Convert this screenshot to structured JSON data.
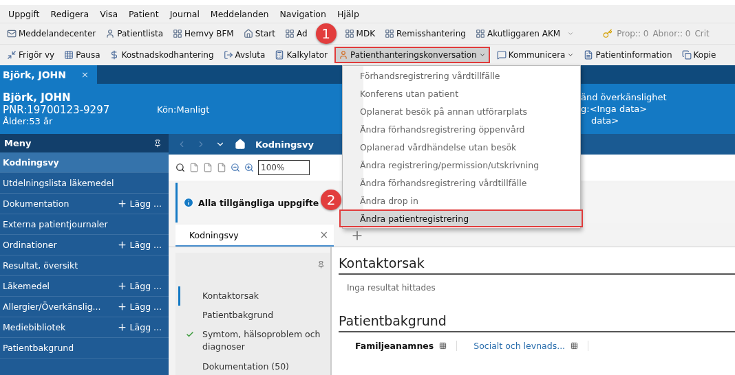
{
  "menu_bar": [
    "Uppgift",
    "Redigera",
    "Visa",
    "Patient",
    "Journal",
    "Meddelanden",
    "Navigation",
    "Hjälp"
  ],
  "toolbar_1": {
    "items": [
      {
        "label": "Meddelandecenter"
      },
      {
        "label": "Patientlista"
      },
      {
        "label": "Hemvy BFM"
      },
      {
        "label": "Start"
      },
      {
        "label": "Ad"
      },
      {
        "label": "MDK"
      },
      {
        "label": "Remisshantering"
      },
      {
        "label": "Akutliggaren AKM"
      }
    ],
    "counters": [
      "Prop:: 0",
      "Abnor:: 0",
      "Crit"
    ]
  },
  "toolbar_2": [
    {
      "label": "Frigör vy",
      "has_menu": false
    },
    {
      "label": "Pausa",
      "has_menu": false
    },
    {
      "label": "Kostnadskodhantering",
      "has_menu": false
    },
    {
      "label": "Avsluta",
      "has_menu": false
    },
    {
      "label": "Kalkylator",
      "has_menu": false
    },
    {
      "label": "Patienthanteringskonversation",
      "has_menu": true,
      "selected": true,
      "callout": "1"
    },
    {
      "label": "Kommunicera",
      "has_menu": true,
      "selected": false
    },
    {
      "label": "Patientinformation",
      "has_menu": false
    },
    {
      "label": "Kopie",
      "has_menu": false
    }
  ],
  "dropdown_menu": [
    {
      "label": "Förhandsregistrering vårdtillfälle",
      "selected": false
    },
    {
      "label": "Konferens utan patient",
      "selected": false
    },
    {
      "label": "Oplanerat besök på annan utförarplats",
      "selected": false
    },
    {
      "label": "Ändra förhandsregistrering öppenvård",
      "selected": false
    },
    {
      "label": "Oplanerad vårdhändelse utan besök",
      "selected": false
    },
    {
      "label": "Ändra registrering/permission/utskrivning",
      "selected": false
    },
    {
      "label": "Ändra förhandsregistrering vårdtillfälle",
      "selected": false
    },
    {
      "label": "Ändra drop in",
      "selected": false
    },
    {
      "label": "Ändra patientregistrering",
      "selected": true,
      "callout": "2"
    }
  ],
  "patient_tab": {
    "label": "Björk, JOHN",
    "close": "×"
  },
  "patient_header": {
    "name": "Björk, JOHN",
    "pnr": "PNR:19700123-9297",
    "age": "Ålder:53 år",
    "gender": "Kön:Manligt",
    "right_lines": [
      "änd överkänslighet",
      "g:<Inga data>",
      "data>"
    ]
  },
  "sidebar": {
    "title": "Meny",
    "items": [
      {
        "label": "Kodningsvy",
        "selected": true
      },
      {
        "label": "Utdelningslista läkemedel",
        "selected": false
      },
      {
        "label": "Dokumentation",
        "selected": false,
        "action": "Lägg ..."
      },
      {
        "label": "Externa patientjournaler",
        "selected": false
      },
      {
        "label": "Ordinationer",
        "selected": false,
        "action": "Lägg ..."
      },
      {
        "label": "Resultat, översikt",
        "selected": false
      },
      {
        "label": "Läkemedel",
        "selected": false,
        "action": "Lägg ..."
      },
      {
        "label": "Allergier/Överkänslig...",
        "selected": false,
        "action": "Lägg ..."
      },
      {
        "label": "Mediebibliotek",
        "selected": false,
        "action": "Lägg ..."
      },
      {
        "label": "Patientbakgrund",
        "selected": false
      }
    ]
  },
  "nav_bar": {
    "title": "Kodningsvy"
  },
  "view_toolbar": {
    "zoom": "100%"
  },
  "info_bar": {
    "text": "Alla tillgängliga uppgifte"
  },
  "view_tabs": [
    {
      "label": "Kodningsvy",
      "selected": true,
      "close": "×"
    }
  ],
  "section_nav": [
    {
      "label": "Kontaktorsak",
      "selected": true,
      "checked": false
    },
    {
      "label": "Patientbakgrund",
      "selected": false,
      "checked": false
    },
    {
      "label": "Symtom, hälsoproblem och diagnoser",
      "selected": false,
      "checked": true
    },
    {
      "label": "Dokumentation (50)",
      "selected": false,
      "checked": false
    }
  ],
  "sections": [
    {
      "title": "Kontaktorsak",
      "empty_text": "Inga resultat hittades"
    },
    {
      "title": "Patientbakgrund",
      "columns": [
        {
          "label": "Familjeanamnes",
          "kind": "bold"
        },
        {
          "label": "Socialt och levnads...",
          "kind": "link"
        }
      ]
    }
  ]
}
